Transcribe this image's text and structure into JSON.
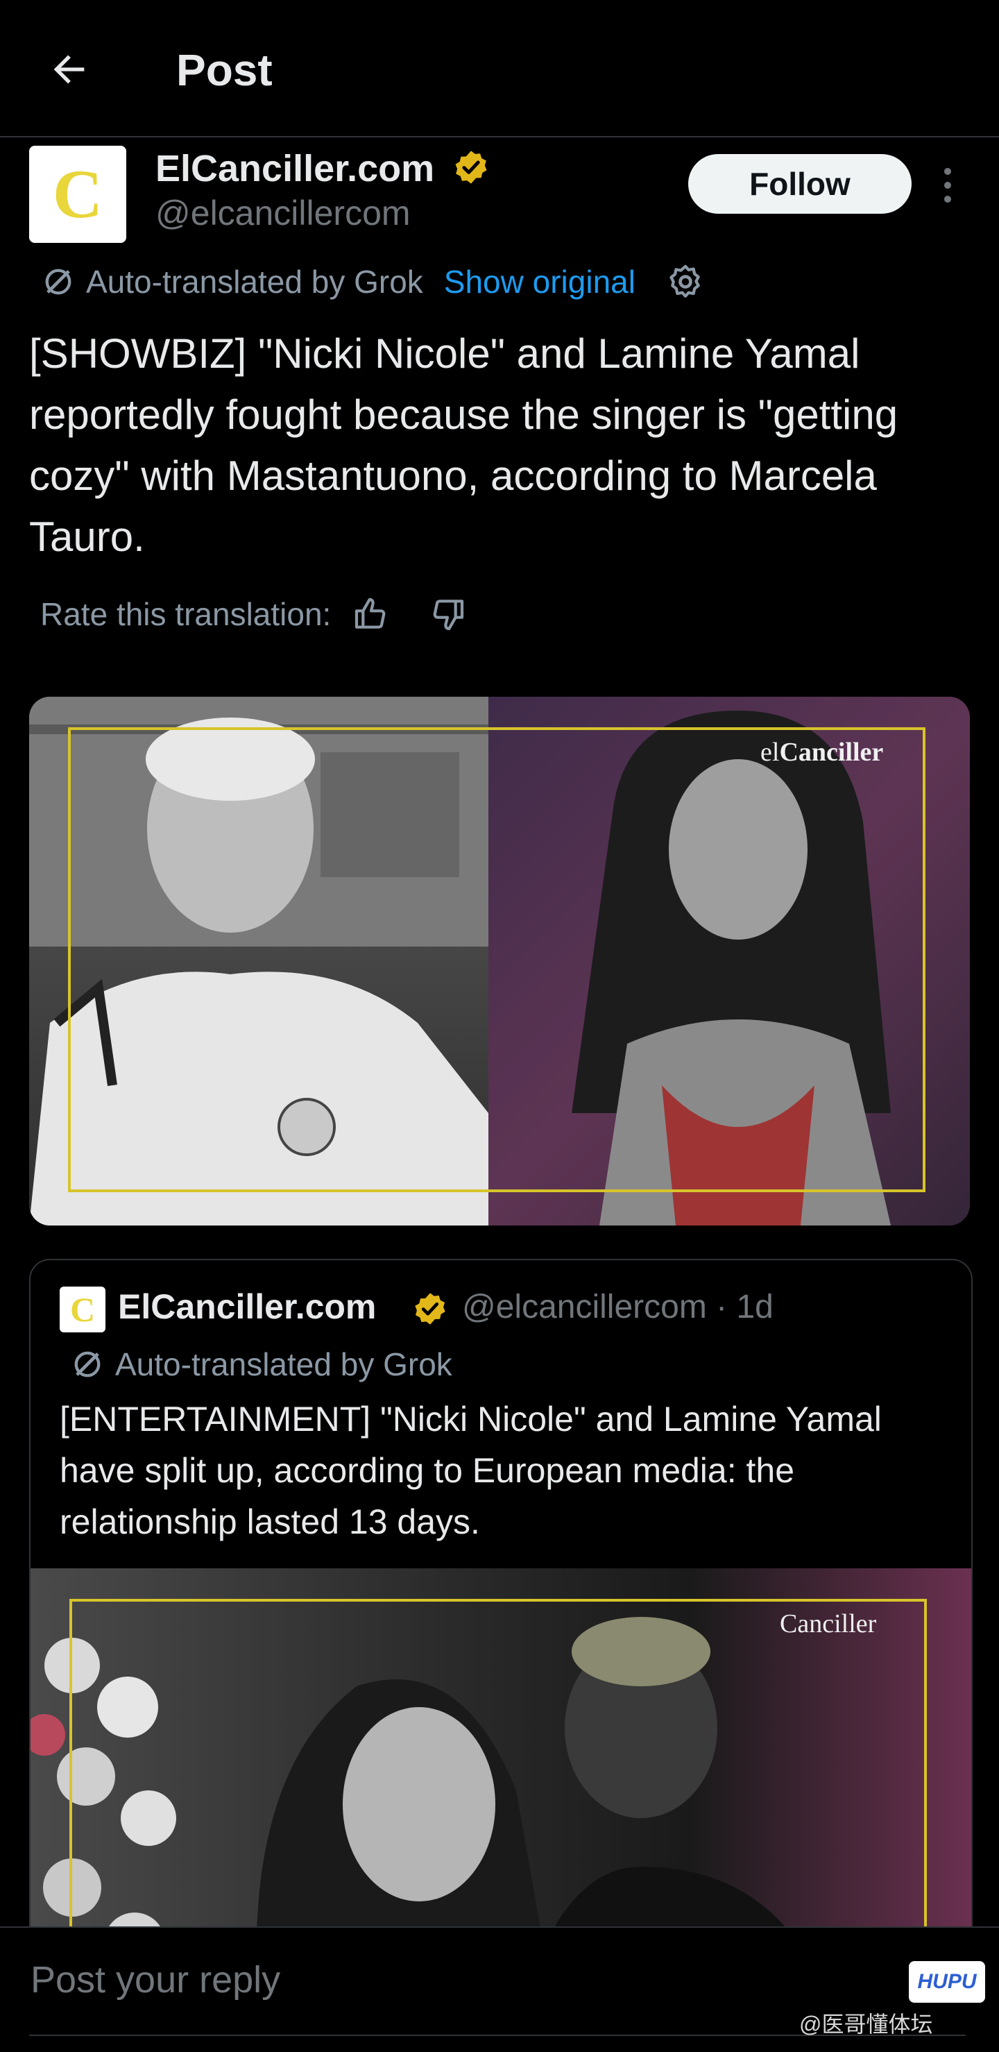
{
  "header": {
    "title": "Post",
    "back_icon": "arrow-left-icon"
  },
  "post": {
    "avatar_letter": "C",
    "author_name": "ElCanciller.com",
    "author_handle": "@elcancillercom",
    "follow_label": "Follow",
    "translation_note": "Auto-translated by Grok",
    "show_original_label": "Show original",
    "text": "[SHOWBIZ] \"Nicki Nicole\" and Lamine Yamal reportedly fought because the singer is \"getting cozy\" with Mastantuono, according to Marcela Tauro.",
    "rate_label": "Rate this translation:",
    "media_watermark": {
      "light": "el",
      "bold": "Canciller"
    }
  },
  "quoted_post": {
    "avatar_letter": "C",
    "author_name": "ElCanciller.com",
    "author_handle": "@elcancillercom · 1d",
    "translation_note": "Auto-translated by Grok",
    "text": "[ENTERTAINMENT] \"Nicki Nicole\" and Lamine Yamal have split up, according to European media: the relationship lasted 13 days.",
    "media_watermark": "Canciller"
  },
  "reply": {
    "placeholder": "Post your reply"
  },
  "overlay": {
    "hupu_logo": "HUPU",
    "weibo_mark": "@医哥懂体坛"
  },
  "colors": {
    "accent": "#1d9bf0",
    "verified": "#e2b719",
    "frame": "#d7c42a",
    "background": "#000000"
  }
}
